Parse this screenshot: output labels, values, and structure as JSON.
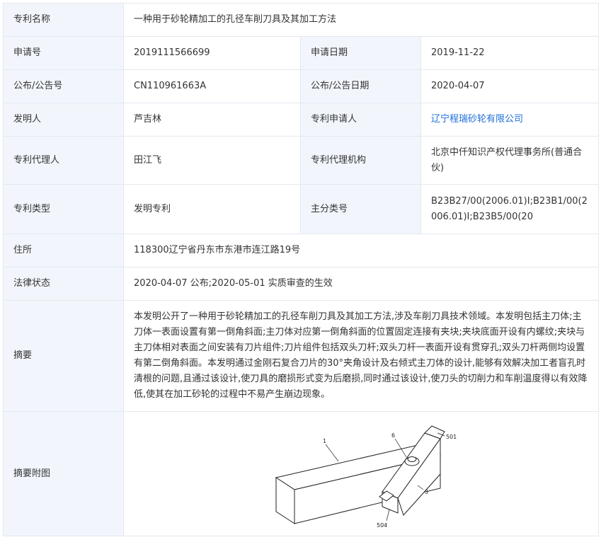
{
  "rows": {
    "name": {
      "label": "专利名称",
      "value": "一种用于砂轮精加工的孔径车削刀具及其加工方法"
    },
    "app_no": {
      "label": "申请号",
      "value": "2019111566699"
    },
    "app_date": {
      "label": "申请日期",
      "value": "2019-11-22"
    },
    "pub_no": {
      "label": "公布/公告号",
      "value": "CN110961663A"
    },
    "pub_date": {
      "label": "公布/公告日期",
      "value": "2020-04-07"
    },
    "inventor": {
      "label": "发明人",
      "value": "芦吉林"
    },
    "applicant": {
      "label": "专利申请人",
      "value": "辽宁程瑞砂轮有限公司"
    },
    "agent": {
      "label": "专利代理人",
      "value": "田江飞"
    },
    "agency": {
      "label": "专利代理机构",
      "value": "北京中仟知识产权代理事务所(普通合伙)"
    },
    "type": {
      "label": "专利类型",
      "value": "发明专利"
    },
    "ipc": {
      "label": "主分类号",
      "value": "B23B27/00(2006.01)I;B23B1/00(2006.01)I;B23B5/00(20"
    },
    "address": {
      "label": "住所",
      "value": "118300辽宁省丹东市东港市连江路19号"
    },
    "legal": {
      "label": "法律状态",
      "value": "2020-04-07 公布;2020-05-01 实质审查的生效"
    },
    "abstract": {
      "label": "摘要",
      "value": "本发明公开了一种用于砂轮精加工的孔径车削刀具及其加工方法,涉及车削刀具技术领域。本发明包括主刀体;主刀体一表面设置有第一倒角斜面;主刀体对应第一倒角斜面的位置固定连接有夹块;夹块底面开设有内螺纹;夹块与主刀体相对表面之间安装有刀片组件;刀片组件包括双头刀杆;双头刀杆一表面开设有贯穿孔;双头刀杆两侧均设置有第二倒角斜面。本发明通过金刚石复合刀片的30°夹角设计及右倾式主刀体的设计,能够有效解决加工者盲孔时清根的问题,且通过该设计,使刀具的磨损形式变为后磨损,同时通过该设计,使刀头的切削力和车削温度得以有效降低,使其在加工砂轮的过程中不易产生崩边现象。"
    },
    "figure": {
      "label": "摘要附图"
    }
  },
  "figure_labels": {
    "l1": "1",
    "l6": "6",
    "l501": "501",
    "l3": "3",
    "l504": "504"
  }
}
